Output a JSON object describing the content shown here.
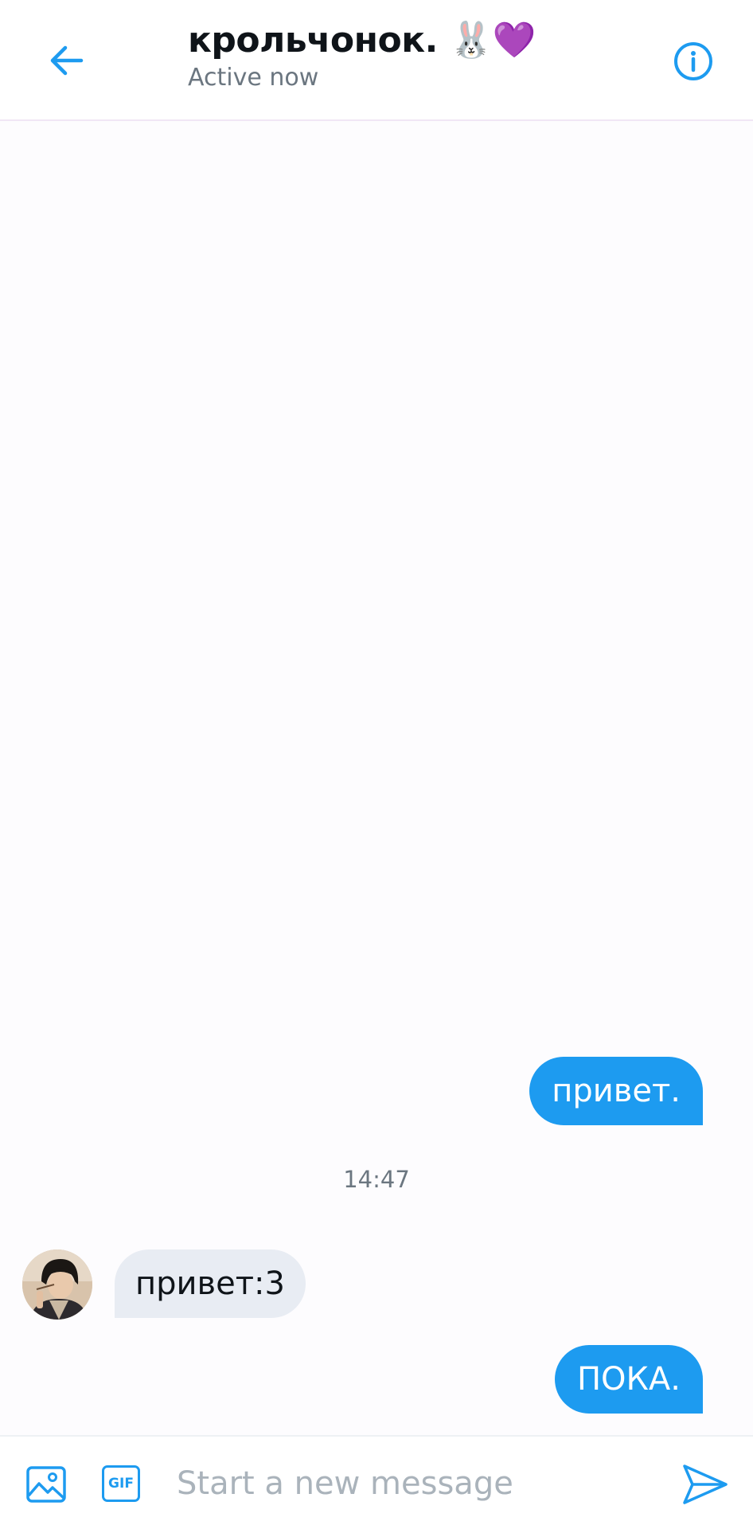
{
  "header": {
    "title": "крольчонок. 🐰💜",
    "status": "Active now"
  },
  "messages": [
    {
      "direction": "outgoing",
      "text": "привет."
    },
    {
      "type": "timestamp",
      "text": "14:47"
    },
    {
      "direction": "incoming",
      "text": "привет:3"
    },
    {
      "direction": "outgoing",
      "text": "ПОКА."
    }
  ],
  "composer": {
    "gif_label": "GIF",
    "placeholder": "Start a new message",
    "value": ""
  },
  "icons": {
    "back": "arrow-left-icon",
    "info": "info-icon",
    "media": "image-icon",
    "gif": "gif-icon",
    "send": "send-icon"
  },
  "colors": {
    "accent": "#1d9bf0",
    "incoming_bubble": "#e8ecf3",
    "outgoing_text": "#ffffff",
    "muted_text": "#6b7680"
  }
}
